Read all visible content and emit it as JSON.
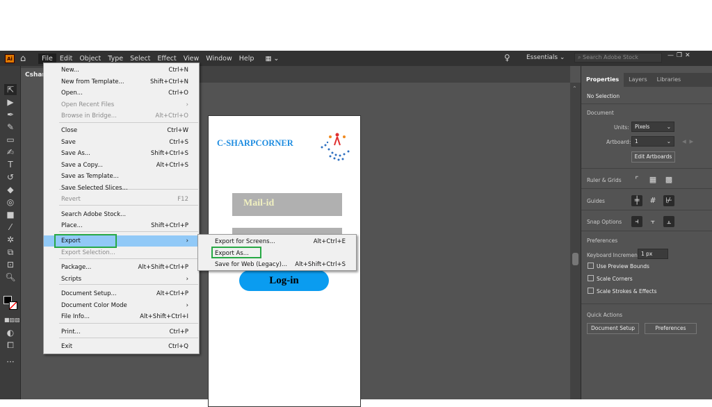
{
  "menubar": {
    "items": [
      "File",
      "Edit",
      "Object",
      "Type",
      "Select",
      "Effect",
      "View",
      "Window",
      "Help"
    ],
    "workspace": "Essentials",
    "search_placeholder": "Search Adobe Stock"
  },
  "doc_tab": "Csharpcorner",
  "file_menu": [
    {
      "label": "New...",
      "shortcut": "Ctrl+N"
    },
    {
      "label": "New from Template...",
      "shortcut": "Shift+Ctrl+N"
    },
    {
      "label": "Open...",
      "shortcut": "Ctrl+O"
    },
    {
      "label": "Open Recent Files",
      "shortcut": "›",
      "disabled": true
    },
    {
      "label": "Browse in Bridge...",
      "shortcut": "Alt+Ctrl+O",
      "disabled": true
    },
    {
      "label": "Close",
      "shortcut": "Ctrl+W"
    },
    {
      "label": "Save",
      "shortcut": "Ctrl+S"
    },
    {
      "label": "Save As...",
      "shortcut": "Shift+Ctrl+S"
    },
    {
      "label": "Save a Copy...",
      "shortcut": "Alt+Ctrl+S"
    },
    {
      "label": "Save as Template...",
      "shortcut": ""
    },
    {
      "label": "Save Selected Slices...",
      "shortcut": ""
    },
    {
      "label": "Revert",
      "shortcut": "F12",
      "disabled": true
    },
    {
      "label": "Search Adobe Stock...",
      "shortcut": ""
    },
    {
      "label": "Place...",
      "shortcut": "Shift+Ctrl+P"
    },
    {
      "label": "Export",
      "shortcut": "›"
    },
    {
      "label": "Export Selection...",
      "shortcut": "",
      "disabled": true
    },
    {
      "label": "Package...",
      "shortcut": "Alt+Shift+Ctrl+P"
    },
    {
      "label": "Scripts",
      "shortcut": "›"
    },
    {
      "label": "Document Setup...",
      "shortcut": "Alt+Ctrl+P"
    },
    {
      "label": "Document Color Mode",
      "shortcut": "›"
    },
    {
      "label": "File Info...",
      "shortcut": "Alt+Shift+Ctrl+I"
    },
    {
      "label": "Print...",
      "shortcut": "Ctrl+P"
    },
    {
      "label": "Exit",
      "shortcut": "Ctrl+Q"
    }
  ],
  "export_submenu": [
    {
      "label": "Export for Screens...",
      "shortcut": "Alt+Ctrl+E"
    },
    {
      "label": "Export As...",
      "shortcut": ""
    },
    {
      "label": "Save for Web (Legacy)...",
      "shortcut": "Alt+Shift+Ctrl+S"
    }
  ],
  "artboard": {
    "logo_text": "C-SHARPCORNER",
    "mail_label": "Mail-id",
    "login_label": "Log-in"
  },
  "panel": {
    "tabs": [
      "Properties",
      "Layers",
      "Libraries"
    ],
    "no_selection": "No Selection",
    "document": "Document",
    "units_label": "Units:",
    "units_value": "Pixels",
    "artboard_label": "Artboard:",
    "artboard_value": "1",
    "edit_artboards": "Edit Artboards",
    "ruler_grids": "Ruler & Grids",
    "guides": "Guides",
    "snap_options": "Snap Options",
    "preferences": "Preferences",
    "keyboard_increment_label": "Keyboard Increment:",
    "keyboard_increment_value": "1 px",
    "checkboxes": [
      "Use Preview Bounds",
      "Scale Corners",
      "Scale Strokes & Effects"
    ],
    "quick_actions": "Quick Actions",
    "document_setup": "Document Setup",
    "preferences_button": "Preferences"
  },
  "colors": {
    "highlight": "#27a844",
    "login": "#0a9cf0",
    "logo": "#1e8ce0"
  }
}
